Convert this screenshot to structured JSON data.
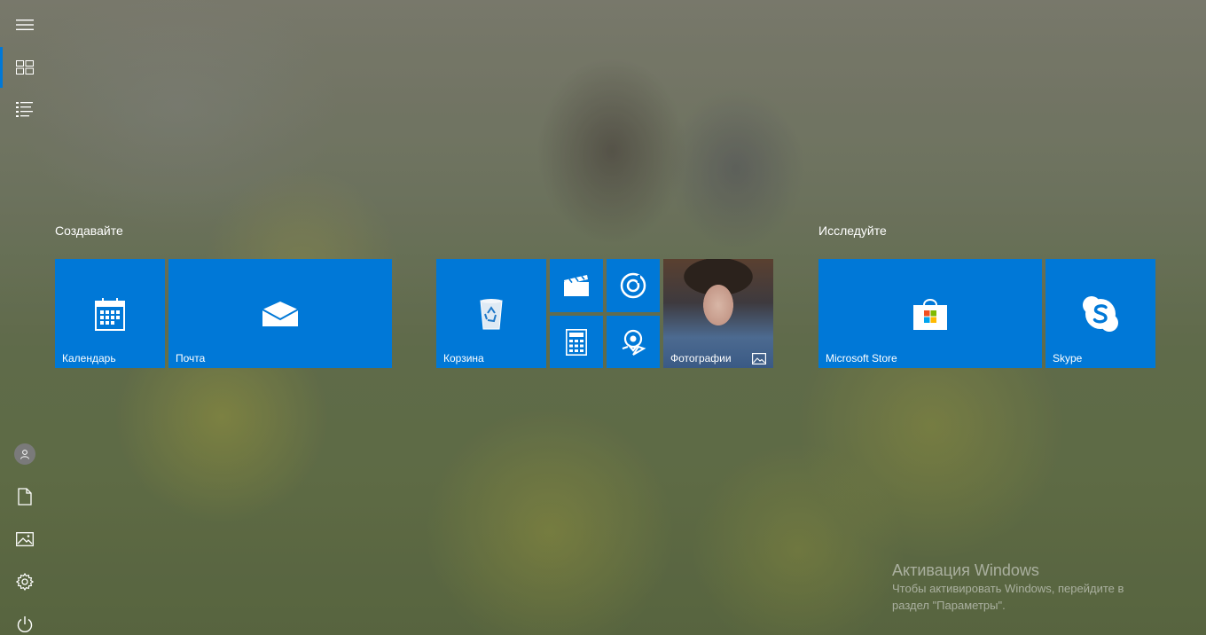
{
  "rail": {
    "items": [
      {
        "name": "hamburger-menu-icon"
      },
      {
        "name": "pinned-tiles-icon"
      },
      {
        "name": "all-apps-list-icon"
      },
      {
        "name": "user-account-icon"
      },
      {
        "name": "documents-icon"
      },
      {
        "name": "pictures-icon"
      },
      {
        "name": "settings-gear-icon"
      },
      {
        "name": "power-icon"
      }
    ],
    "accent_color": "#0078d7"
  },
  "groups": [
    {
      "title": "Создавайте",
      "tiles": [
        {
          "label": "Календарь",
          "icon": "calendar-icon"
        },
        {
          "label": "Почта",
          "icon": "mail-icon"
        }
      ]
    },
    {
      "title": "",
      "tiles": [
        {
          "label": "Корзина",
          "icon": "recycle-bin-icon"
        },
        {
          "label": "",
          "icon": "movies-tv-icon"
        },
        {
          "label": "",
          "icon": "groove-music-icon"
        },
        {
          "label": "",
          "icon": "calculator-icon"
        },
        {
          "label": "",
          "icon": "maps-icon"
        },
        {
          "label": "Фотографии",
          "icon": "photos-icon"
        }
      ]
    },
    {
      "title": "Исследуйте",
      "tiles": [
        {
          "label": "Microsoft Store",
          "icon": "store-bag-icon"
        },
        {
          "label": "Skype",
          "icon": "skype-icon"
        }
      ]
    }
  ],
  "tile_color": "#0078d7",
  "activation": {
    "title": "Активация Windows",
    "line1": "Чтобы активировать Windows, перейдите в",
    "line2": "раздел \"Параметры\"."
  }
}
